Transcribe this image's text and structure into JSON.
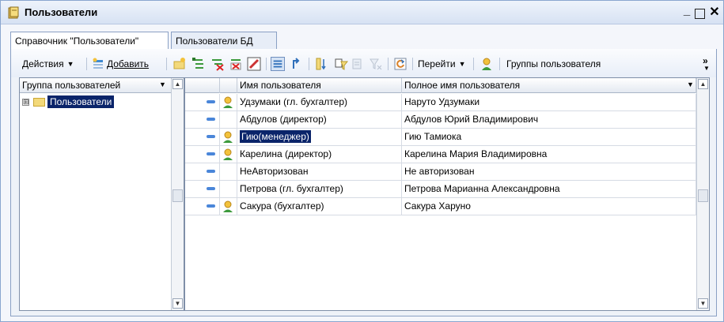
{
  "window": {
    "title": "Пользователи",
    "icon": "book-icon",
    "controls": [
      "minimize-icon",
      "maximize-icon",
      "close-icon"
    ]
  },
  "tabs": [
    {
      "label": "Справочник \"Пользователи\"",
      "active": true
    },
    {
      "label": "Пользователи БД",
      "active": false
    }
  ],
  "toolbar": {
    "actions_label": "Действия",
    "add_label": "Добавить",
    "goto_label": "Перейти",
    "groups_label": "Группы пользователя",
    "more_label": "»"
  },
  "tree": {
    "header": "Группа пользователей",
    "root": {
      "label": "Пользователи",
      "expander": "⊞"
    }
  },
  "grid": {
    "columns": [
      "Имя пользователя",
      "Полное имя пользователя"
    ],
    "rows": [
      {
        "name": "Удзумаки (гл. бухгалтер)",
        "full_name": "Наруто Удзумаки",
        "has_user_icon": true,
        "selected": false
      },
      {
        "name": "Абдулов (директор)",
        "full_name": "Абдулов Юрий Владимирович",
        "has_user_icon": false,
        "selected": false
      },
      {
        "name": "Гию(менеджер)",
        "full_name": "Гию Тамиока",
        "has_user_icon": true,
        "selected": true
      },
      {
        "name": "Карелина (директор)",
        "full_name": "Карелина Мария Владимировна",
        "has_user_icon": true,
        "selected": false
      },
      {
        "name": "НеАвторизован",
        "full_name": "Не авторизован",
        "has_user_icon": false,
        "selected": false
      },
      {
        "name": "Петрова (гл. бухгалтер)",
        "full_name": "Петрова Марианна Александровна",
        "has_user_icon": false,
        "selected": false
      },
      {
        "name": "Сакура (бухгалтер)",
        "full_name": "Сакура Харуно",
        "has_user_icon": true,
        "selected": false
      }
    ]
  },
  "colors": {
    "selection": "#0a246a",
    "accent": "#4a86d9",
    "border": "#8aa0c4"
  }
}
